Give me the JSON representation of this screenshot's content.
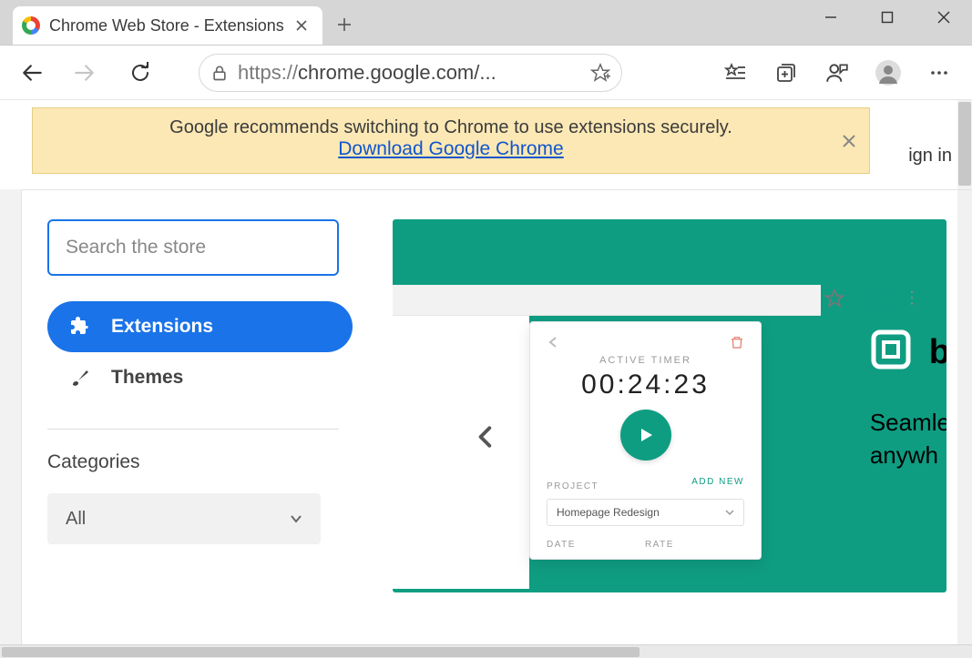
{
  "window": {
    "tab_title": "Chrome Web Store - Extensions"
  },
  "address": {
    "protocol": "https://",
    "display": "chrome.google.com/..."
  },
  "notification": {
    "text": "Google recommends switching to Chrome to use extensions securely.",
    "link": "Download Google Chrome"
  },
  "header": {
    "signin": "ign in"
  },
  "sidebar": {
    "search_placeholder": "Search the store",
    "nav": [
      {
        "label": "Extensions"
      },
      {
        "label": "Themes"
      }
    ],
    "categories_title": "Categories",
    "category_selected": "All"
  },
  "hero": {
    "brand_letter": "b",
    "tagline_l1": "Seamle",
    "tagline_l2": "anywh",
    "popup": {
      "label": "ACTIVE TIMER",
      "time": "00:24:23",
      "project_label": "PROJECT",
      "add_new": "ADD NEW",
      "project_value": "Homepage Redesign",
      "date_label": "DATE",
      "rate_label": "RATE"
    }
  }
}
